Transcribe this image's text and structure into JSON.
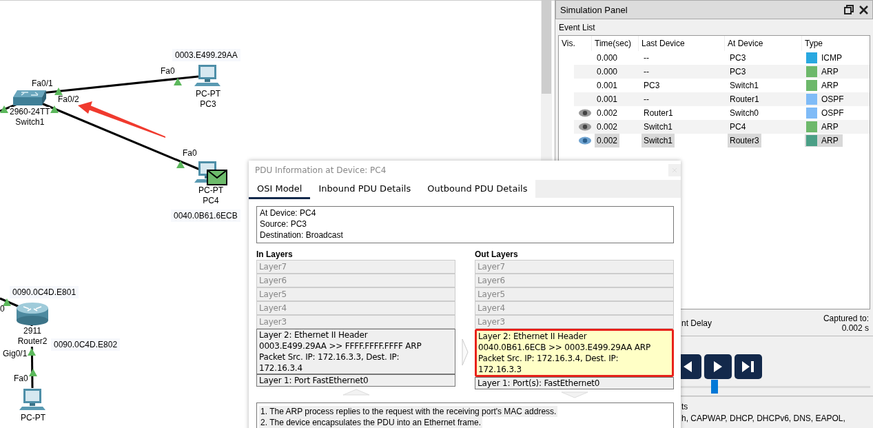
{
  "topology": {
    "devices": [
      {
        "kind": "switch",
        "model": "2960-24TT",
        "name": "Switch1"
      },
      {
        "kind": "pc",
        "model": "PC-PT",
        "name": "PC3",
        "has_pdu": false
      },
      {
        "kind": "pc",
        "model": "PC-PT",
        "name": "PC4",
        "has_pdu": true
      },
      {
        "kind": "router",
        "model": "2911",
        "name": "Router2"
      },
      {
        "kind": "pc",
        "model": "PC-PT",
        "has_pdu": false
      }
    ],
    "port_labels": [
      "Fa0/1",
      "Fa0/2",
      "Fa0",
      "Fa0",
      "0",
      "Gig0/1",
      "Fa0"
    ],
    "address_labels": [
      "0003.E499.29AA",
      "0040.0B61.6ECB",
      "0090.0C4D.E801",
      "0090.0C4D.E802"
    ]
  },
  "simulation_panel": {
    "title": "Simulation Panel",
    "event_list": {
      "label": "Event List",
      "columns": [
        "Vis.",
        "Time(sec)",
        "Last Device",
        "At Device",
        "Type"
      ],
      "rows": [
        {
          "visible": false,
          "selected": false,
          "time": "0.000",
          "last_device": "--",
          "at_device": "PC3",
          "type": "ICMP",
          "color": "#29a8e0"
        },
        {
          "visible": false,
          "selected": false,
          "time": "0.000",
          "last_device": "--",
          "at_device": "PC3",
          "type": "ARP",
          "color": "#6db86b"
        },
        {
          "visible": false,
          "selected": false,
          "time": "0.001",
          "last_device": "PC3",
          "at_device": "Switch1",
          "type": "ARP",
          "color": "#6db86b"
        },
        {
          "visible": false,
          "selected": false,
          "time": "0.001",
          "last_device": "--",
          "at_device": "Router1",
          "type": "OSPF",
          "color": "#7fbbf7"
        },
        {
          "visible": true,
          "selected": false,
          "time": "0.002",
          "last_device": "Router1",
          "at_device": "Switch0",
          "type": "OSPF",
          "color": "#7fbbf7"
        },
        {
          "visible": true,
          "selected": false,
          "time": "0.002",
          "last_device": "Switch1",
          "at_device": "PC4",
          "type": "ARP",
          "color": "#6db86b"
        },
        {
          "visible": true,
          "selected": true,
          "time": "0.002",
          "last_device": "Switch1",
          "at_device": "Router3",
          "type": "ARP",
          "color": "#4a9f86"
        }
      ]
    },
    "delay_fragment": "nt Delay",
    "captured_label": "Captured to:",
    "captured_value": "0.002 s",
    "playback": {
      "level": 0.5
    },
    "filters_fragment": "ts",
    "filters_line": "h, CAPWAP, DHCP, DHCPv6, DNS, EAPOL,"
  },
  "pdu_dialog": {
    "title": "PDU Information at Device: PC4",
    "tabs": [
      {
        "label": "OSI Model",
        "selected": true
      },
      {
        "label": "Inbound PDU Details",
        "selected": false
      },
      {
        "label": "Outbound PDU Details",
        "selected": false
      }
    ],
    "info": [
      "At Device: PC4",
      "Source: PC3",
      "Destination: Broadcast"
    ],
    "in_layers": {
      "heading": "In Layers",
      "layers": [
        {
          "text": "Layer7",
          "disabled": true,
          "selected": false
        },
        {
          "text": "Layer6",
          "disabled": true,
          "selected": false
        },
        {
          "text": "Layer5",
          "disabled": true,
          "selected": false
        },
        {
          "text": "Layer4",
          "disabled": true,
          "selected": false
        },
        {
          "text": "Layer3",
          "disabled": true,
          "selected": false
        },
        {
          "text": "Layer 2: Ethernet II Header\n0003.E499.29AA >> FFFF.FFFF.FFFF ARP\nPacket Src. IP: 172.16.3.3, Dest. IP:\n172.16.3.4",
          "disabled": false,
          "selected": false
        },
        {
          "text": "Layer 1: Port FastEthernet0",
          "disabled": false,
          "selected": false
        }
      ]
    },
    "out_layers": {
      "heading": "Out Layers",
      "layers": [
        {
          "text": "Layer7",
          "disabled": true,
          "selected": false
        },
        {
          "text": "Layer6",
          "disabled": true,
          "selected": false
        },
        {
          "text": "Layer5",
          "disabled": true,
          "selected": false
        },
        {
          "text": "Layer4",
          "disabled": true,
          "selected": false
        },
        {
          "text": "Layer3",
          "disabled": true,
          "selected": false
        },
        {
          "text": "Layer 2: Ethernet II Header\n0040.0B61.6ECB >> 0003.E499.29AA ARP\nPacket Src. IP: 172.16.3.4, Dest. IP:\n172.16.3.3",
          "disabled": false,
          "selected": true
        },
        {
          "text": "Layer 1: Port(s): FastEthernet0",
          "disabled": false,
          "selected": false
        }
      ]
    },
    "description": [
      "1. The ARP process replies to the request with the receiving port's MAC address.",
      "2. The device encapsulates the PDU into an Ethernet frame."
    ]
  }
}
